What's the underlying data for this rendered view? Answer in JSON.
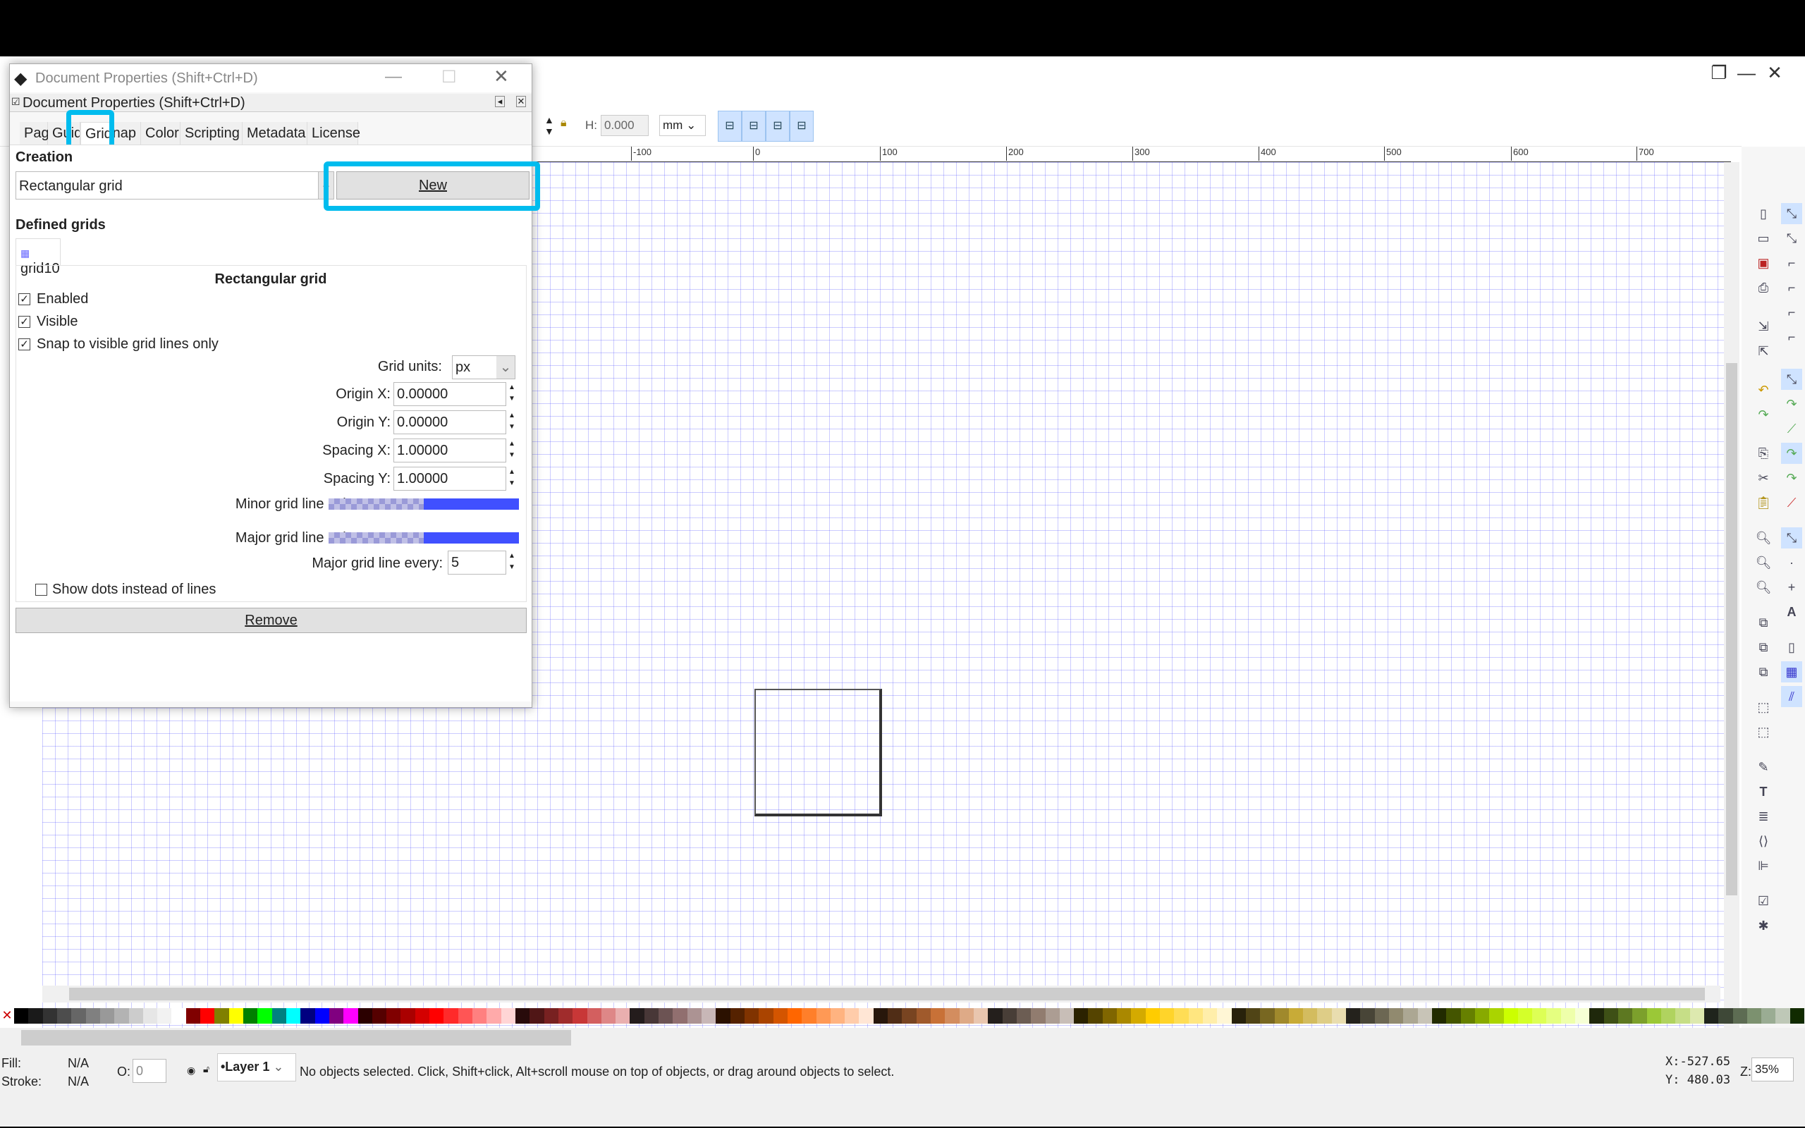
{
  "window": {
    "controls": [
      "—",
      "❐",
      "✕"
    ]
  },
  "toolbar": {
    "h_label": "H:",
    "h_value": "0.000",
    "unit": "mm"
  },
  "ruler": {
    "ticks": [
      "-100",
      "0",
      "100",
      "200",
      "300",
      "400",
      "500",
      "600",
      "700"
    ]
  },
  "dialog": {
    "title": "Document Properties (Shift+Ctrl+D)",
    "panel_title": "Document Properties (Shift+Ctrl+D)",
    "tabs": [
      "Page",
      "Guides",
      "Grids",
      "Snap",
      "Color",
      "Scripting",
      "Metadata",
      "License"
    ],
    "active_tab": "Grids",
    "creation_label": "Creation",
    "grid_type": "Rectangular grid",
    "new_button": "New",
    "defined_grids_label": "Defined grids",
    "grid_tab": "grid10",
    "section_title": "Rectangular grid",
    "enabled": {
      "label": "Enabled",
      "checked": true
    },
    "visible": {
      "label": "Visible",
      "checked": true
    },
    "snap_visible": {
      "label": "Snap to visible grid lines only",
      "checked": true
    },
    "grid_units_label": "Grid units:",
    "grid_units": "px",
    "origin_x_label": "Origin X:",
    "origin_x": "0.00000",
    "origin_y_label": "Origin Y:",
    "origin_y": "0.00000",
    "spacing_x_label": "Spacing X:",
    "spacing_x": "1.00000",
    "spacing_y_label": "Spacing Y:",
    "spacing_y": "1.00000",
    "minor_color_label": "Minor grid line color:",
    "minor_color": "#3f3fff",
    "major_color_label": "Major grid line color:",
    "major_color": "#3f3fff",
    "major_every_label": "Major grid line every:",
    "major_every": "5",
    "show_dots": {
      "label": "Show dots instead of lines",
      "checked": false
    },
    "remove_button": "Remove"
  },
  "palette": [
    "#000000",
    "#1a1a1a",
    "#333333",
    "#4d4d4d",
    "#666666",
    "#808080",
    "#999999",
    "#b3b3b3",
    "#cccccc",
    "#e6e6e6",
    "#f2f2f2",
    "#ffffff",
    "#800000",
    "#ff0000",
    "#808000",
    "#ffff00",
    "#008000",
    "#00ff00",
    "#008080",
    "#00ffff",
    "#000080",
    "#0000ff",
    "#800080",
    "#ff00ff",
    "#2b0000",
    "#550000",
    "#800000",
    "#aa0000",
    "#d40000",
    "#ff0000",
    "#ff2a2a",
    "#ff5555",
    "#ff8080",
    "#ffaaaa",
    "#ffd5d5",
    "#280b0b",
    "#501616",
    "#782121",
    "#a02c2c",
    "#c83737",
    "#d35f5f",
    "#de8787",
    "#e9afaf",
    "#241c1c",
    "#483737",
    "#6c5353",
    "#916f6f",
    "#ac9393",
    "#c8b7b7",
    "#2b1100",
    "#552200",
    "#803300",
    "#aa4400",
    "#d45500",
    "#ff6600",
    "#ff7f2a",
    "#ff9955",
    "#ffb380",
    "#ffccaa",
    "#ffe6d5",
    "#28170b",
    "#502d16",
    "#784421",
    "#a05a2c",
    "#c87137",
    "#d38d5f",
    "#deaa87",
    "#e9c6af",
    "#241f1c",
    "#483e37",
    "#6c5d53",
    "#917c6f",
    "#ac9d93",
    "#c8beb7",
    "#2b2200",
    "#554400",
    "#806600",
    "#aa8800",
    "#d4aa00",
    "#ffcc00",
    "#ffd42a",
    "#ffdd55",
    "#ffe680",
    "#ffeeaa",
    "#fff6d5",
    "#28220b",
    "#504416",
    "#786721",
    "#a0892c",
    "#c8ab37",
    "#d3bc5f",
    "#decd87",
    "#e9ddaf",
    "#24221c",
    "#484537",
    "#6c6753",
    "#918a6f",
    "#aca793",
    "#c8c4b7",
    "#222b00",
    "#445500",
    "#668000",
    "#88aa00",
    "#aad400",
    "#ccff00",
    "#d4ff2a",
    "#ddff55",
    "#e5ff80",
    "#eeffaa",
    "#f6ffd5",
    "#1f280b",
    "#3e5016",
    "#5d7821",
    "#7ca02c",
    "#9bc837",
    "#b0d35f",
    "#c6de87",
    "#dde9af",
    "#1f241c",
    "#3e4837",
    "#5d6c53",
    "#7c916f",
    "#9aac93",
    "#bec8b7",
    "#112b00"
  ],
  "status": {
    "fill_label": "Fill:",
    "fill_value": "N/A",
    "stroke_label": "Stroke:",
    "stroke_value": "N/A",
    "opacity_label": "O:",
    "opacity_value": "0",
    "layer": "•Layer 1",
    "message": "No objects selected. Click, Shift+click, Alt+scroll mouse on top of objects, or drag around objects to select.",
    "x_label": "X:",
    "x_value": "-527.65",
    "y_label": "Y:",
    "y_value": "480.03",
    "zoom_label": "Z:",
    "zoom_value": "35%"
  },
  "highlight_color": "#00bcee"
}
